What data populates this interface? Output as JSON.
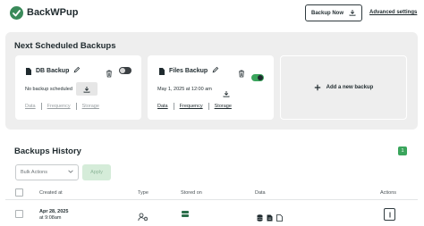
{
  "header": {
    "brand": "BackWPup",
    "backup_now_label": "Backup Now",
    "advanced_settings_label": "Advanced settings"
  },
  "scheduled": {
    "title": "Next Scheduled Backups",
    "cards": [
      {
        "title": "DB Backup",
        "enabled": false,
        "status_text": "No backup scheduled",
        "links": [
          "Data",
          "Frequency",
          "Storage"
        ],
        "links_muted": true
      },
      {
        "title": "Files Backup",
        "enabled": true,
        "status_text": "May 1, 2025 at 12:00 am",
        "links": [
          "Data",
          "Frequency",
          "Storage"
        ],
        "links_muted": false
      }
    ],
    "add_label": "Add a new backup"
  },
  "history": {
    "title": "Backups History",
    "count": "1",
    "bulk_select_value": "Bulk Actions",
    "apply_label": "Apply",
    "columns": [
      "Created at",
      "Type",
      "Stored on",
      "Data",
      "Actions"
    ],
    "rows": [
      {
        "date": "Apr 28, 2025",
        "time": "at 9:08am",
        "type_icon": "user-gear-icon",
        "storage_icon": "server-storage-icon",
        "data_icons": [
          "database-icon",
          "document-icon",
          "file-icon"
        ],
        "action_icon": "more-vertical-icon"
      }
    ]
  },
  "colors": {
    "accent": "#3aa55c",
    "brand_green": "#3a8a5a",
    "panel_bg": "#eeeeee",
    "text": "#1f2a2e"
  }
}
